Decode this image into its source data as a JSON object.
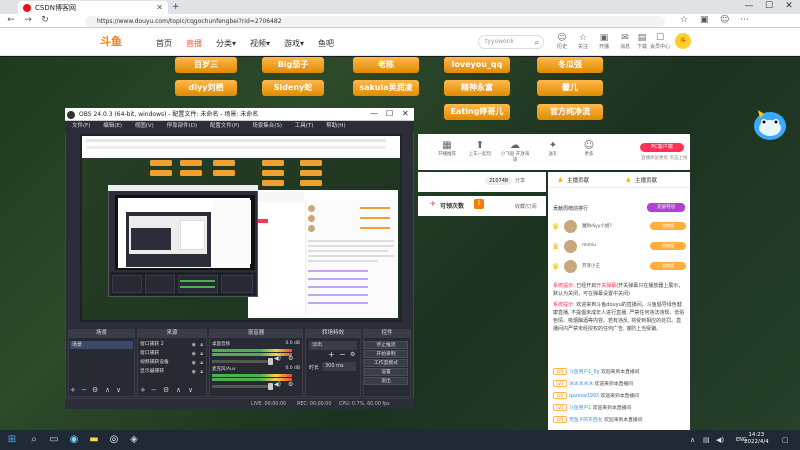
{
  "browser": {
    "tab_title": "CSDN博客网",
    "new_tab": "+",
    "url": "https://www.douyu.com/topic/cqgochunfengbei?rid=2706482",
    "win_min": "—",
    "win_max": "☐",
    "win_close": "✕",
    "back": "←",
    "forward": "→",
    "reload": "↻"
  },
  "douyu": {
    "logo": "斗鱼",
    "nav": [
      "首页",
      "直播",
      "分类▾",
      "视频▾",
      "游戏▾",
      "鱼吧"
    ],
    "search_placeholder": "tyyowonk",
    "header_icons": [
      {
        "glyph": "☺",
        "label": "历史"
      },
      {
        "glyph": "☆",
        "label": "关注"
      },
      {
        "glyph": "▣",
        "label": "开播"
      },
      {
        "glyph": "✉",
        "label": "消息"
      },
      {
        "glyph": "▤",
        "label": "下载"
      },
      {
        "glyph": "☐",
        "label": "会员中心"
      }
    ],
    "avatar": "斗"
  },
  "tags": [
    "百岁三",
    "Big茄子",
    "老陈",
    "loveyou_qq",
    "冬瓜强",
    "diyy刘栖",
    "Sideny蛇",
    "sakula吴润凌",
    "精神永富",
    "馨儿",
    "Eating婷哥儿",
    "官方纯净流"
  ],
  "room": {
    "buttons": [
      {
        "glyph": "▦",
        "label": "开播推荐"
      },
      {
        "glyph": "⬆",
        "label": "上车一起玩"
      },
      {
        "glyph": "☁",
        "label": "小飞船·开放海域"
      },
      {
        "glyph": "✦",
        "label": "送礼"
      },
      {
        "glyph": "☺",
        "label": "更多"
      }
    ],
    "pc_button": "PC客户端",
    "pc_sub": "直播体验更优 点击上线",
    "count": "210748",
    "share": "分享",
    "collect": "收藏/订阅",
    "fish_label": "可领次数",
    "fish_badge": "1"
  },
  "chat": {
    "tab_left": "主播贡献",
    "tab_right": "主播贡献",
    "rank_title": "贡献周榜前排行",
    "rank_button": "充值夺冠",
    "rank_rows": [
      {
        "name": "魔防diyy小姐?",
        "lv": "贡献值"
      },
      {
        "name": "mimiu",
        "lv": "贡献值"
      },
      {
        "name": "苏菲小王",
        "lv": "贡献值"
      }
    ],
    "sys_label1": "系统提示:",
    "sys_text1": " 已经开启",
    "sys_red1": "开关弹幕",
    "sys_text1b": "(开关弹幕只在播放器上展示，默认为关闭，可在弹幕设置中关闭)",
    "sys_label2": "系统提示:",
    "sys_text2": " 欢迎来到斗鱼douyu的直播间。斗鱼倡导绿色健康直播, 不提倡未成年人进行直播, 严禁任何违法违规、低俗色情、吸烟酗酒等内容。若有违反, 将受到相应的处罚。直播间内严禁未经授权的任何广告, 谨防上当受骗。",
    "welcomes": [
      {
        "lv": "LV3",
        "user": "斗鱼用户1_6y",
        "msg": "欢迎来到本直播间"
      },
      {
        "lv": "LV3",
        "user": "冰冰冰冰冰",
        "msg": "欢迎来到本直播间"
      },
      {
        "lv": "LV2",
        "user": "qazxsw1993",
        "msg": "欢迎来到本直播间"
      },
      {
        "lv": "LV1",
        "user": "斗鱼用户1",
        "msg": "欢迎来到本直播间"
      },
      {
        "lv": "LV1",
        "user": "荒鱼子的东西女",
        "msg": "欢迎来到本直播间"
      },
      {
        "lv": "LV2",
        "user": "tyyowonk",
        "msg": "欢迎来到本直播间"
      }
    ]
  },
  "obs": {
    "title": "OBS 24.0.3 (64-bit, windows) - 配置文件: 未命名 - 场景: 未命名",
    "menu": [
      "文件(F)",
      "编辑(E)",
      "视图(V)",
      "停靠部件(D)",
      "配置文件(P)",
      "场景集合(S)",
      "工具(T)",
      "帮助(H)"
    ],
    "docks": {
      "scenes": "场景",
      "sources": "来源",
      "mixer": "混音器",
      "transitions": "转场特效",
      "controls": "控件"
    },
    "scene_item": "场景",
    "sources_list": [
      "窗口捕获 2",
      "窗口捕获",
      "视频捕获设备",
      "显示器捕获"
    ],
    "mixer_rows": [
      {
        "label": "桌面音频",
        "db": "0.0 dB"
      },
      {
        "label": "麦克风/Aux",
        "db": "0.0 dB"
      }
    ],
    "transition": "淡出",
    "duration_label": "时长",
    "duration": "300 ms",
    "controls": [
      "停止推流",
      "开始录制",
      "工作室模式",
      "设置",
      "退出"
    ],
    "status": {
      "live": "LIVE: 00:00:00",
      "rec": "REC: 00:00:00",
      "cpu": "CPU: 0.7%, 60.00 fps"
    }
  },
  "taskbar": {
    "time": "14:23",
    "date": "2022/4/4",
    "lang": "ENG"
  }
}
